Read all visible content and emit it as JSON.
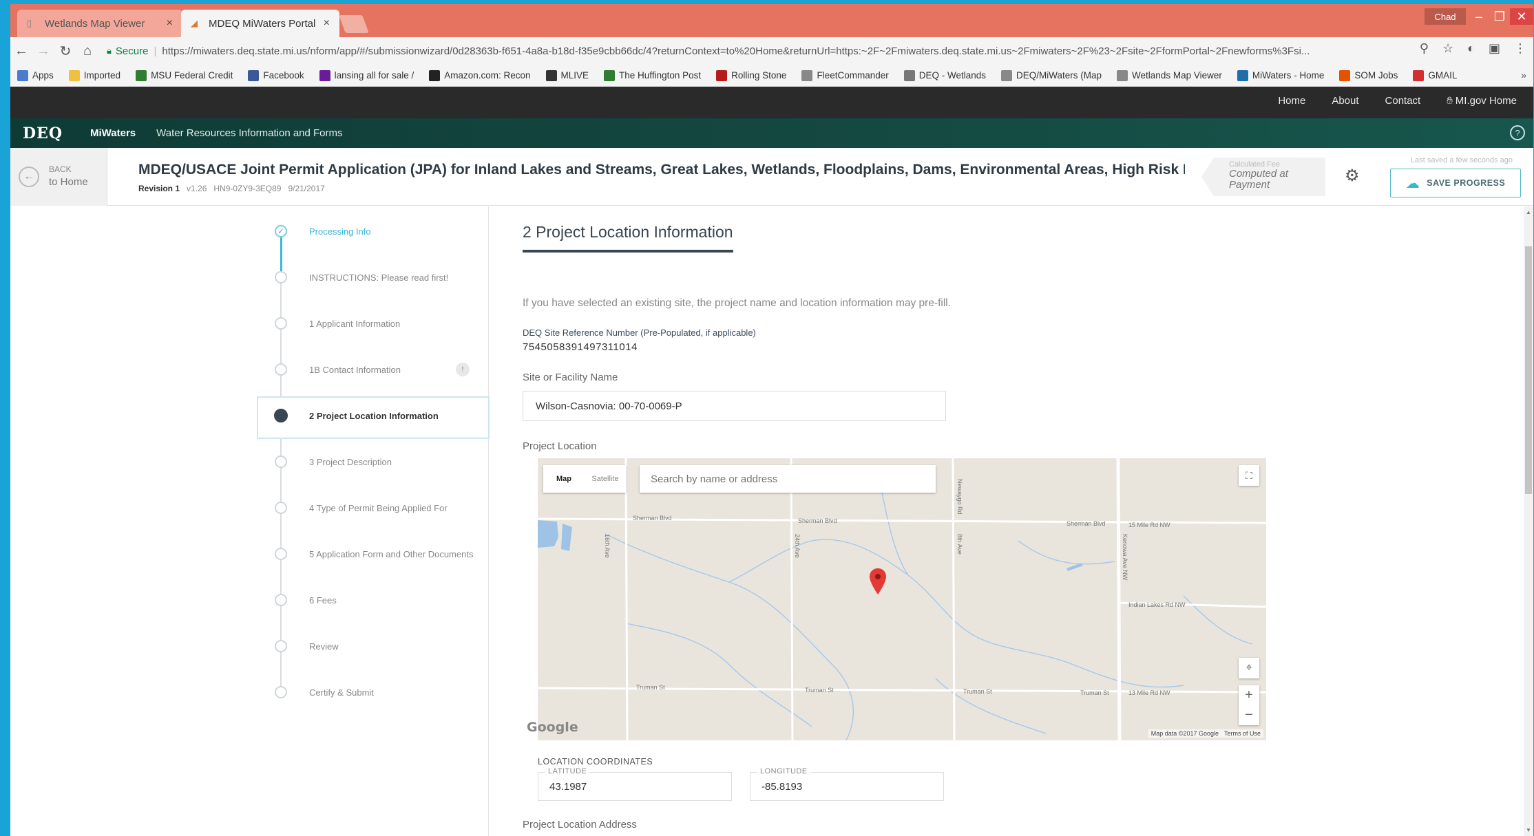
{
  "browser": {
    "tabs": [
      {
        "title": "Wetlands Map Viewer",
        "active": false
      },
      {
        "title": "MDEQ MiWaters Portal",
        "active": true
      }
    ],
    "profile": "Chad",
    "secure_label": "Secure",
    "url": "https://miwaters.deq.state.mi.us/nform/app/#/submissionwizard/0d28363b-f651-4a8a-b18d-f35e9cbb66dc/4?returnContext=to%20Home&returnUrl=https:~2F~2Fmiwaters.deq.state.mi.us~2Fmiwaters~2F%23~2Fsite~2FformPortal~2Fnewforms%3Fsi..."
  },
  "bookmarks": [
    {
      "label": "Apps",
      "icon": "apps-grid-icon",
      "color": "#4a7bd0"
    },
    {
      "label": "Imported",
      "icon": "folder-icon",
      "color": "#f0c040"
    },
    {
      "label": "MSU Federal Credit",
      "icon": "msu-icon",
      "color": "#2e7d32"
    },
    {
      "label": "Facebook",
      "icon": "facebook-icon",
      "color": "#3b5998"
    },
    {
      "label": "lansing all for sale /",
      "icon": "craigslist-icon",
      "color": "#6a1b9a"
    },
    {
      "label": "Amazon.com: Recon",
      "icon": "amazon-icon",
      "color": "#222222"
    },
    {
      "label": "MLIVE",
      "icon": "mlive-icon",
      "color": "#333333"
    },
    {
      "label": "The Huffington Post",
      "icon": "huffpost-icon",
      "color": "#2e7d32"
    },
    {
      "label": "Rolling Stone",
      "icon": "rollingstone-icon",
      "color": "#b71c1c"
    },
    {
      "label": "FleetCommander",
      "icon": "page-icon",
      "color": "#888888"
    },
    {
      "label": "DEQ - Wetlands",
      "icon": "deq-icon",
      "color": "#777777"
    },
    {
      "label": "DEQ/MiWaters (Map",
      "icon": "page-icon",
      "color": "#888888"
    },
    {
      "label": "Wetlands Map Viewer",
      "icon": "page-icon",
      "color": "#888888"
    },
    {
      "label": "MiWaters - Home",
      "icon": "miwaters-icon",
      "color": "#1e6fa8"
    },
    {
      "label": "SOM Jobs",
      "icon": "som-icon",
      "color": "#e65100"
    },
    {
      "label": "GMAIL",
      "icon": "gmail-icon",
      "color": "#d32f2f"
    }
  ],
  "sitenav": {
    "links": [
      "Home",
      "About",
      "Contact"
    ],
    "migov": "MI.gov Home"
  },
  "deqbar": {
    "logo": "DEQ",
    "app": "MiWaters",
    "subtitle": "Water Resources Information and Forms"
  },
  "formhead": {
    "back_small": "BACK",
    "back_big": "to Home",
    "title": "MDEQ/USACE Joint Permit Application (JPA) for Inland Lakes and Streams, Great Lakes, Wetlands, Floodplains, Dams, Environmental Areas, High Risk Erosi...",
    "revision": "Revision 1",
    "version": "v1.26",
    "code": "HN9-0ZY9-3EQ89",
    "date": "9/21/2017",
    "fee_label": "Calculated Fee",
    "fee_value": "Computed at Payment",
    "last_saved": "Last saved a few seconds ago",
    "save_label": "SAVE PROGRESS"
  },
  "steps": [
    {
      "label": "Processing Info",
      "state": "done"
    },
    {
      "label": "INSTRUCTIONS: Please read first!",
      "state": "todo"
    },
    {
      "label": "1 Applicant Information",
      "state": "todo"
    },
    {
      "label": "1B Contact Information",
      "state": "todo",
      "badge": "!"
    },
    {
      "label": "2 Project Location Information",
      "state": "current"
    },
    {
      "label": "3 Project Description",
      "state": "todo"
    },
    {
      "label": "4 Type of Permit Being Applied For",
      "state": "todo"
    },
    {
      "label": "5 Application Form and Other Documents",
      "state": "todo"
    },
    {
      "label": "6 Fees",
      "state": "todo"
    },
    {
      "label": "Review",
      "state": "todo"
    },
    {
      "label": "Certify & Submit",
      "state": "todo"
    }
  ],
  "content": {
    "section_title": "2 Project Location Information",
    "intro": "If you have selected an existing site, the project name and location information may pre-fill.",
    "ref_label": "DEQ Site Reference Number (Pre-Populated, if applicable)",
    "ref_value": "7545058391497311014",
    "site_label": "Site or Facility Name",
    "site_value": "Wilson-Casnovia: 00-70-0069-P",
    "location_label": "Project Location",
    "map": {
      "type_map": "Map",
      "type_satellite": "Satellite",
      "search_placeholder": "Search by name or address",
      "google": "Google",
      "map_data": "Map data ©2017 Google",
      "terms": "Terms of Use",
      "roads": {
        "sherman1": "Sherman Blvd",
        "sherman2": "Sherman Blvd",
        "sherman3": "Sherman Blvd",
        "sherman4": "15 Mile Rd NW",
        "truman1": "Truman St",
        "truman2": "Truman St",
        "truman3": "Truman St",
        "truman4": "Truman St",
        "truman5": "13 Mile Rd NW",
        "indian": "Indian Lakes Rd NW",
        "ave1": "16th Ave",
        "ave2": "24th Ave",
        "ave3": "Newaygo Rd",
        "ave4": "8th Ave",
        "ave5": "Kenowa Ave NW"
      }
    },
    "coord_title": "LOCATION COORDINATES",
    "lat_label": "LATITUDE",
    "lat_value": "43.1987",
    "lon_label": "LONGITUDE",
    "lon_value": "-85.8193",
    "address_label": "Project Location Address"
  },
  "colors": {
    "accent": "#3bb5dc",
    "header_green": "#144a42",
    "marker": "#e53935"
  }
}
